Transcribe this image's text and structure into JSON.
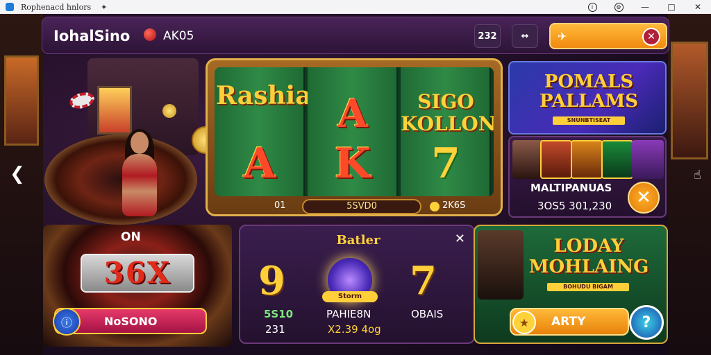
{
  "window": {
    "title": "Rophenacd hnlors",
    "pin_icon": "pin-icon",
    "controls": [
      "info-icon",
      "settings-icon",
      "minimize-icon",
      "maximize-icon",
      "close-icon"
    ],
    "minimize_glyph": "—",
    "maximize_glyph": "□",
    "close_glyph": "✕"
  },
  "header": {
    "brand": "IohalSino",
    "brand_sub": "AK05",
    "btn1": "232",
    "btn2": "↔",
    "cta_close": "✕"
  },
  "slot": {
    "logo": "Rashiai",
    "reel_top": [
      "A",
      "SIGO KOLLON"
    ],
    "reel_bottom": [
      "A",
      "K",
      "7"
    ],
    "left_label": "01",
    "bet_value": "5SVD0",
    "credits": "2K6S"
  },
  "promo_top": {
    "title": "POMALS PALLAMS",
    "subtitle": "SNUNBTISEAT"
  },
  "multi": {
    "name": "MALTIPANUAS",
    "amount": "3OS5 301,230",
    "close": "✕"
  },
  "roulette": {
    "on_label": "ON",
    "number": "36X",
    "button_label": "NoSONO"
  },
  "center": {
    "title": "Batler",
    "close": "✕",
    "left_num": "9",
    "right_num": "7",
    "orb_label": "Storm",
    "left_line1": "5S10",
    "left_line2": "231",
    "mid_line1": "PAHIE8N",
    "mid_line2": "X2.39 4og",
    "right_line1": "OBAIS"
  },
  "promo_bottom": {
    "title": "LODAY MOHLAING",
    "subtitle": "BOHUDU BIGAM",
    "button_label": "ARTY",
    "help": "?"
  }
}
